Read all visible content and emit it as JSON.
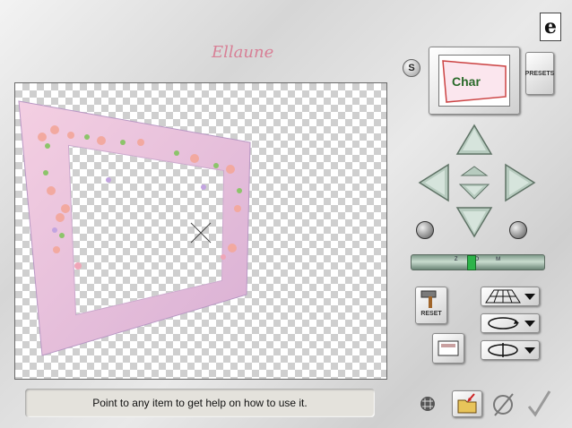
{
  "app": {
    "logo_text": "Ellaune",
    "corner_icon": "e",
    "s_button": "S",
    "presets_label": "PRESETS"
  },
  "status": {
    "help_text": "Point to any item to get help on how to use it."
  },
  "preview": {
    "thumb_text": "Char"
  },
  "slider": {
    "labels": [
      "Z",
      "O",
      "M"
    ],
    "value": 0.45
  },
  "tools": {
    "reset_label": "RESET"
  },
  "icons": {
    "corner": "e-logo-icon",
    "move_up": "arrow-up-icon",
    "move_down": "arrow-down-icon",
    "move_left": "arrow-left-icon",
    "move_right": "arrow-right-icon",
    "rotate_left": "rotate-left-icon",
    "rotate_right": "rotate-right-icon",
    "grid_dd": "perspective-grid-icon",
    "rotate_dd": "rotate-circle-icon",
    "flip_dd": "flip-rotate-icon",
    "frame": "frame-preview-icon",
    "grid": "grid-icon",
    "open": "open-folder-icon",
    "cancel": "cancel-icon",
    "ok": "check-icon"
  },
  "colors": {
    "accent": "#d86a86",
    "slider_thumb": "#2db34a",
    "button_face": "#a9c0b4"
  }
}
